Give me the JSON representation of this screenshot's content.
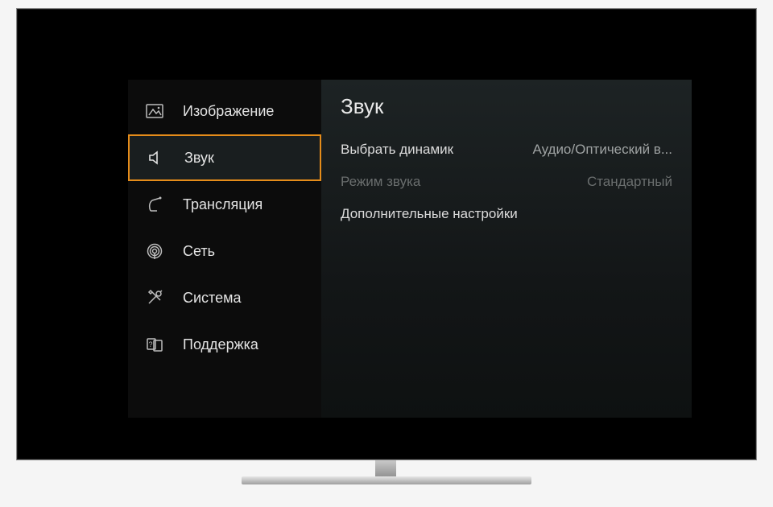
{
  "sidebar": {
    "items": [
      {
        "label": "Изображение",
        "icon": "picture-icon",
        "selected": false
      },
      {
        "label": "Звук",
        "icon": "sound-icon",
        "selected": true
      },
      {
        "label": "Трансляция",
        "icon": "broadcast-icon",
        "selected": false
      },
      {
        "label": "Сеть",
        "icon": "network-icon",
        "selected": false
      },
      {
        "label": "Система",
        "icon": "system-icon",
        "selected": false
      },
      {
        "label": "Поддержка",
        "icon": "support-icon",
        "selected": false
      }
    ]
  },
  "main": {
    "title": "Звук",
    "rows": [
      {
        "label": "Выбрать динамик",
        "value": "Аудио/Оптический в...",
        "disabled": false
      },
      {
        "label": "Режим звука",
        "value": "Стандартный",
        "disabled": true
      },
      {
        "label": "Дополнительные настройки",
        "value": "",
        "disabled": false
      }
    ]
  }
}
